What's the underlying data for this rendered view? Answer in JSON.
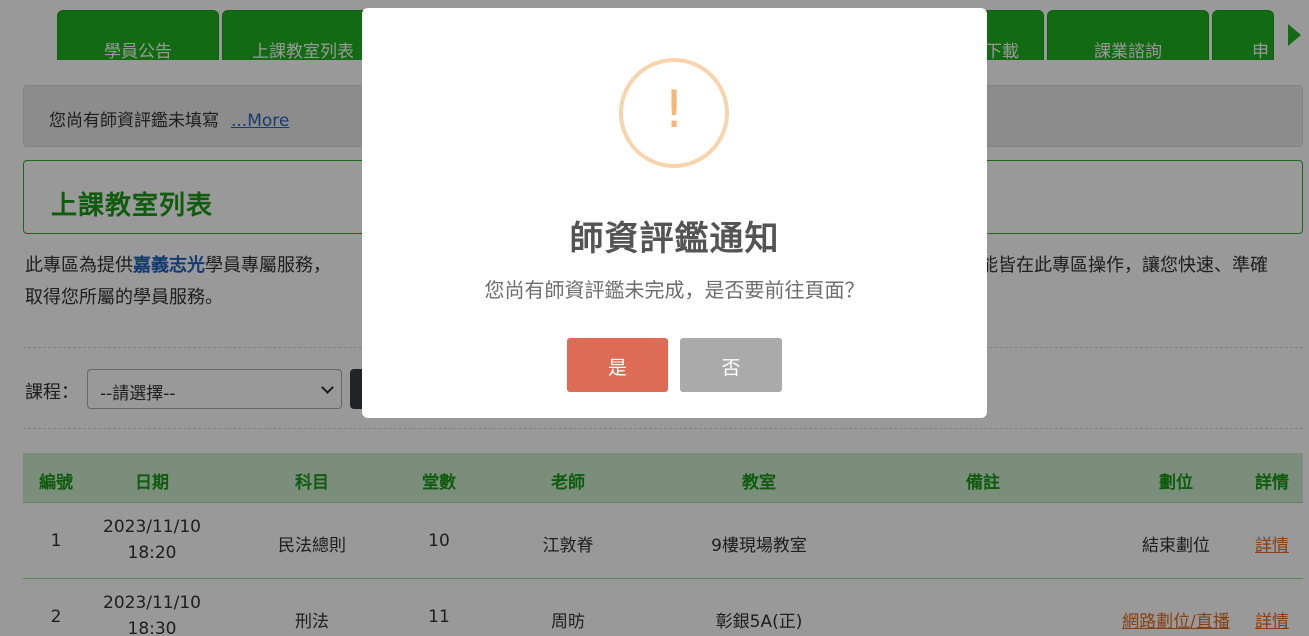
{
  "tabs": [
    {
      "label": "學員公告"
    },
    {
      "label": "上課教室列表"
    },
    {
      "label": "下載"
    },
    {
      "label": "課業諮詢"
    },
    {
      "label": "申"
    }
  ],
  "notice": {
    "text": "您尚有師資評鑑未填寫",
    "link": "...More"
  },
  "section_title": "上課教室列表",
  "intro": {
    "line1_prefix": "此專區為提供",
    "line1_highlight": "嘉義志光",
    "line1_suffix": "學員專屬服務，",
    "line1_right": "能皆在此專區操作，讓您快速、準確",
    "line2": "取得您所屬的學員服務。"
  },
  "filter": {
    "label": "課程：",
    "select_value": "--請選擇--"
  },
  "table": {
    "headers": [
      "編號",
      "日期",
      "科目",
      "堂數",
      "老師",
      "教室",
      "備註",
      "劃位",
      "詳情"
    ],
    "rows": [
      {
        "no": "1",
        "date": "2023/11/10",
        "time": "18:20",
        "subject": "民法總則",
        "sessions": "10",
        "teacher": "江敦脊",
        "room": "9樓現場教室",
        "note": "",
        "seat": "結束劃位",
        "detail": "詳情"
      },
      {
        "no": "2",
        "date": "2023/11/10",
        "time": "18:30",
        "subject": "刑法",
        "sessions": "11",
        "teacher": "周昉",
        "room": "彰銀5A(正)",
        "note": "",
        "seat": "網路劃位/直播",
        "detail": "詳情"
      }
    ]
  },
  "modal": {
    "icon": "exclamation-icon",
    "icon_glyph": "!",
    "title": "師資評鑑通知",
    "message": "您尚有師資評鑑未完成，是否要前往頁面？",
    "yes_label": "是",
    "no_label": "否",
    "colors": {
      "yes": "#dd6b55",
      "no": "#aaaaaa",
      "warning": "#f8bb86"
    }
  }
}
